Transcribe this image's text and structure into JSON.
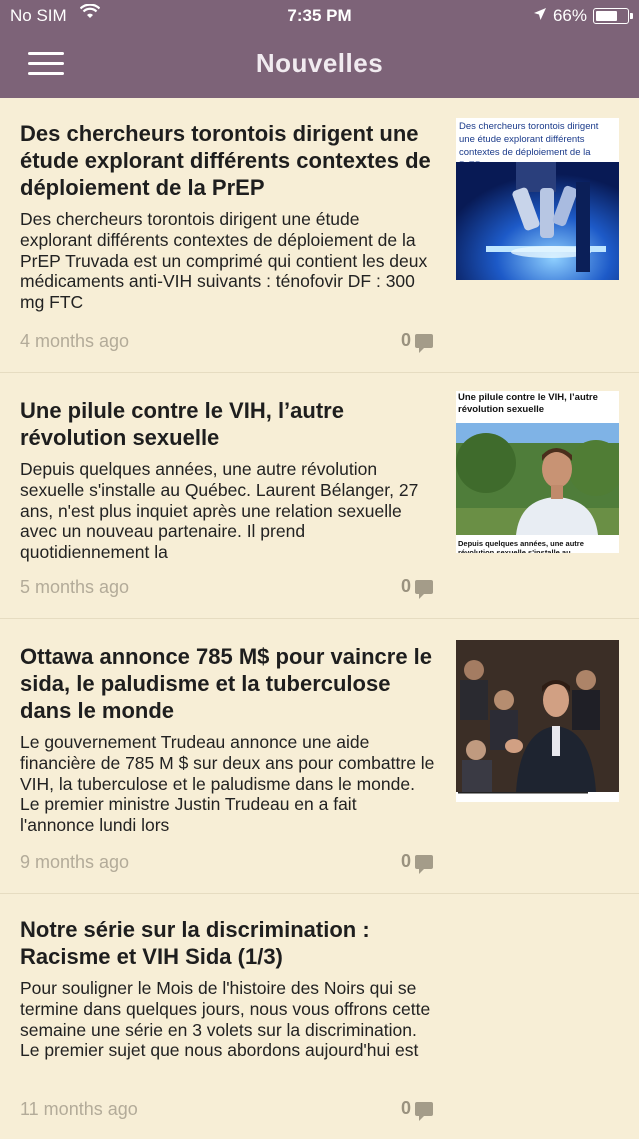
{
  "status": {
    "carrier": "No SIM",
    "time": "7:35 PM",
    "battery": "66%"
  },
  "header": {
    "title": "Nouvelles"
  },
  "articles": [
    {
      "title": "Des chercheurs torontois dirigent une étude explorant différents contextes de déploiement de la PrEP",
      "excerpt": "Des chercheurs torontois dirigent une étude explorant différents contextes de déploiement de la PrEP Truvada est un comprimé qui contient les deux médicaments anti-VIH suivants : ténofovir DF : 300 mg FTC",
      "date": "4 months ago",
      "comments": "0",
      "thumb_caption": "Des chercheurs torontois dirigent une étude explorant différents contextes de déploiement de la PrEP."
    },
    {
      "title": "Une pilule contre le VIH, l’autre révolution sexuelle",
      "excerpt": "Depuis quelques années, une autre révolution sexuelle s'installe au Québec. Laurent Bélanger, 27 ans, n'est plus inquiet après une relation sexuelle avec un nouveau partenaire. Il prend quotidiennement la",
      "date": "5 months ago",
      "comments": "0",
      "thumb_caption": "Une pilule contre le VIH, l’autre révolution sexuelle",
      "thumb_footer": "Depuis quelques années, une autre révolution sexuelle s'installe au"
    },
    {
      "title": "Ottawa annonce 785 M$ pour vaincre le sida, le paludisme et la tuberculose dans le monde",
      "excerpt": "Le gouvernement Trudeau annonce une aide financière de 785 M $ sur deux ans pour combattre le VIH, la tuberculose et le paludisme dans le monde. Le premier ministre Justin Trudeau en a fait l'annonce lundi lors",
      "date": "9 months ago",
      "comments": "0"
    },
    {
      "title": "Notre série sur la discrimination : Racisme et VIH Sida (1/3)",
      "excerpt": "Pour souligner le Mois de l'histoire des Noirs qui se termine dans quelques jours, nous vous offrons cette semaine une série en 3 volets sur la discrimination. Le premier sujet que nous abordons aujourd'hui est",
      "date": "11 months ago",
      "comments": "0"
    }
  ],
  "colors": {
    "header": "#7d6378",
    "background": "#f7eed6"
  }
}
